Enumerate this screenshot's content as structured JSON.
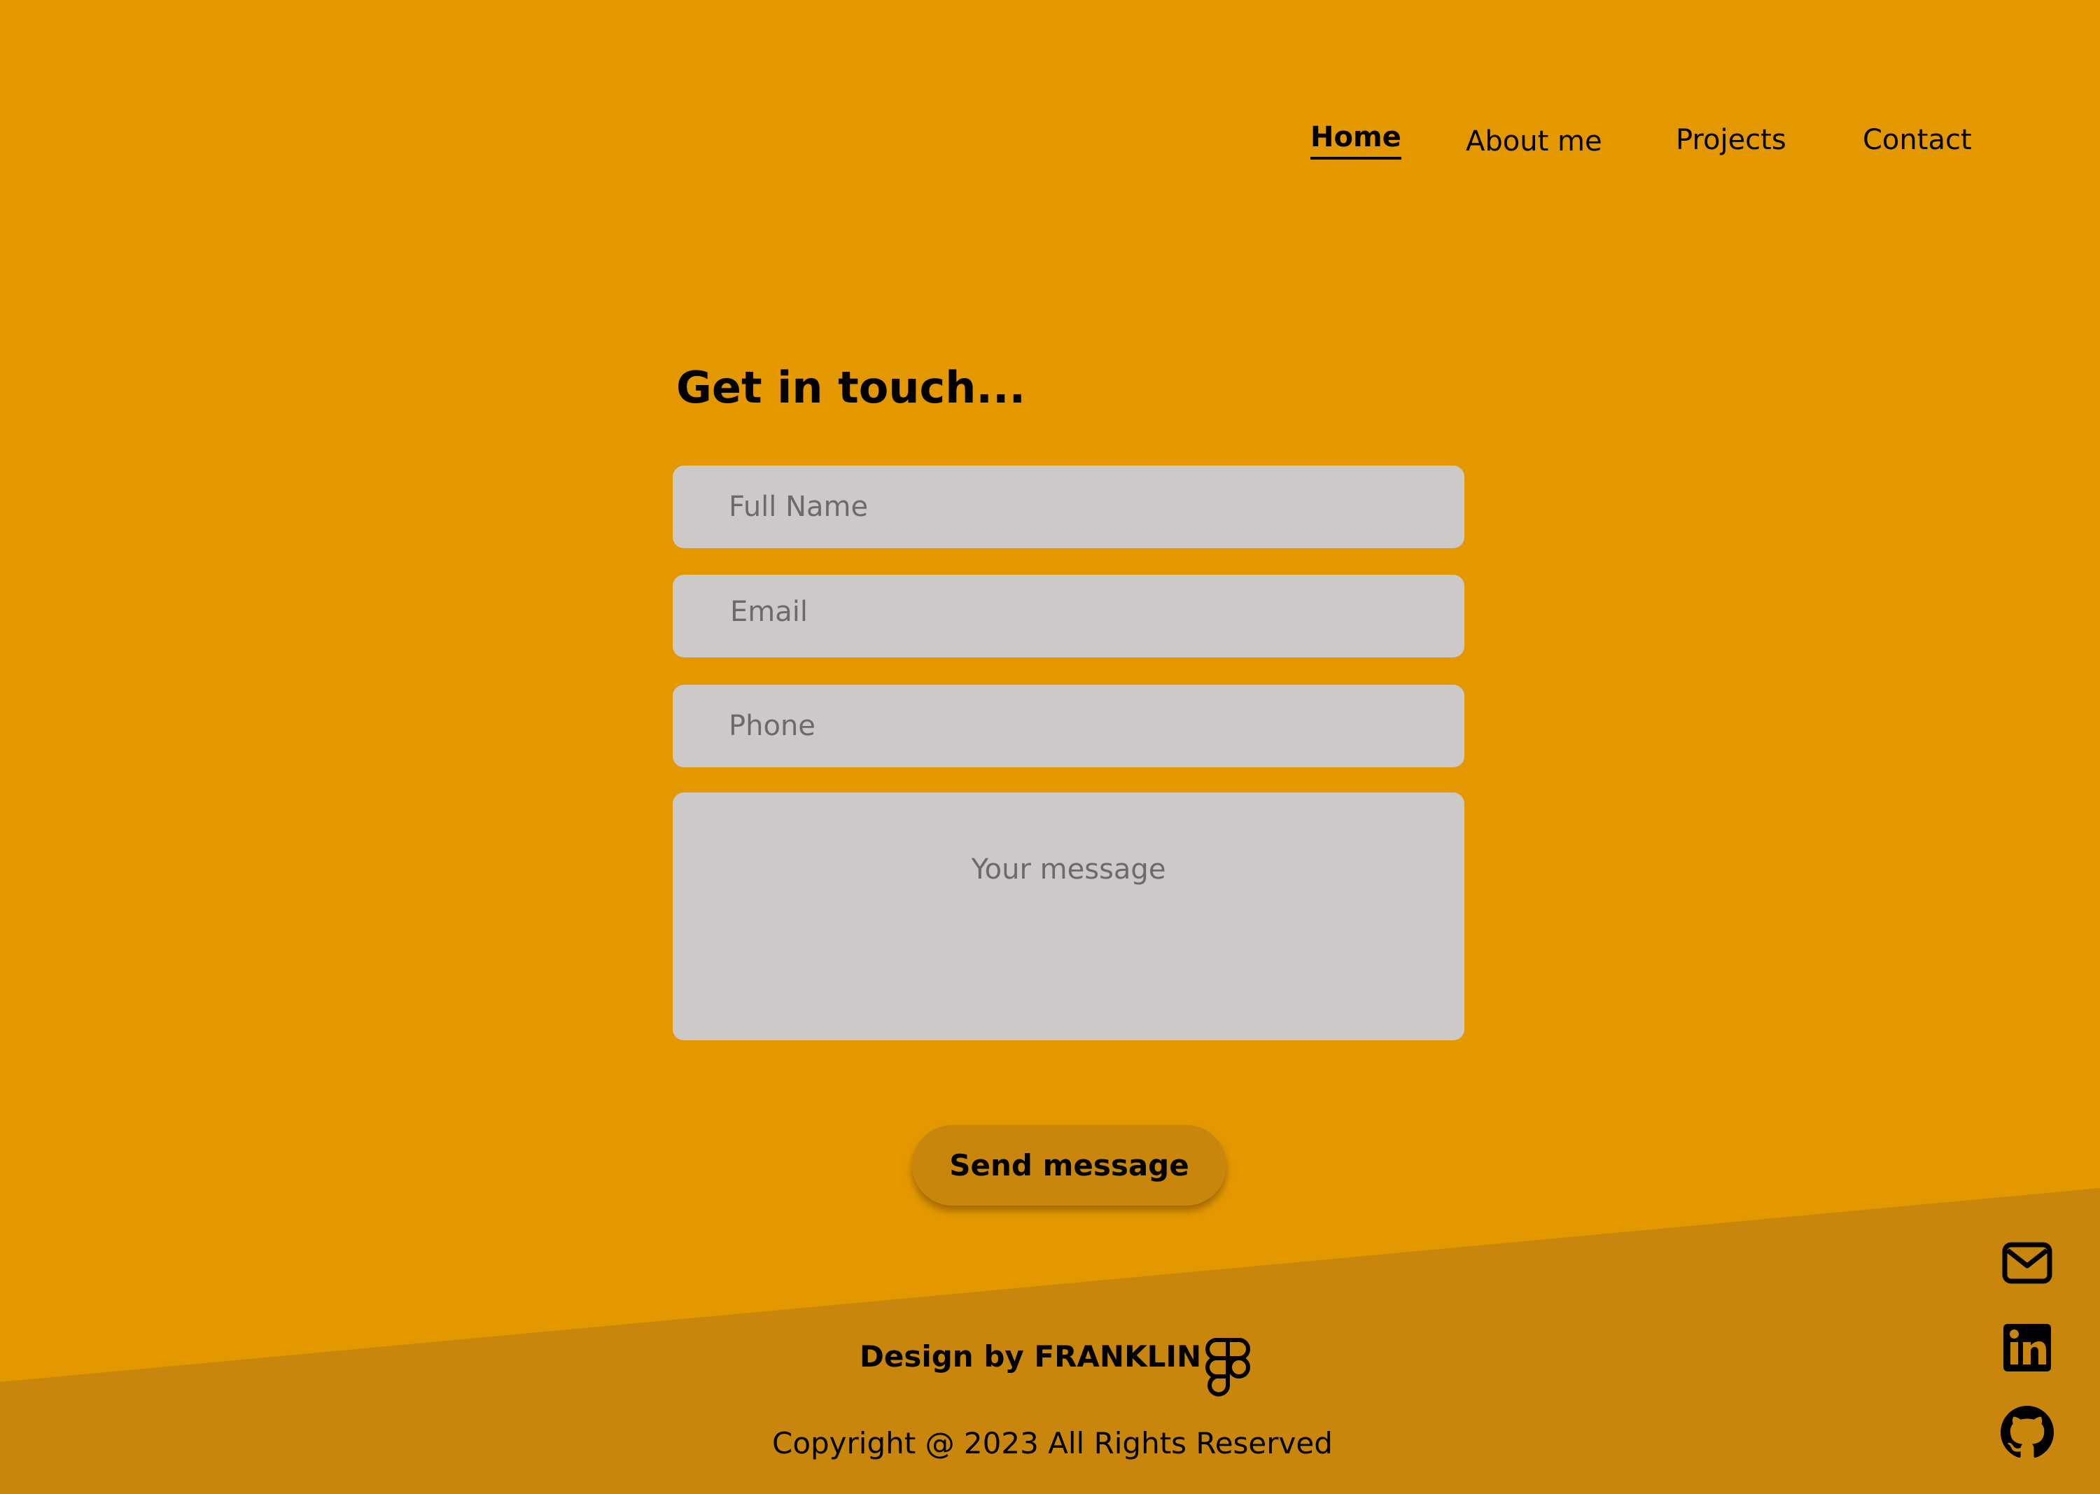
{
  "nav": {
    "items": [
      {
        "label": "Home",
        "active": true
      },
      {
        "label": "About me",
        "active": false
      },
      {
        "label": "Projects",
        "active": false
      },
      {
        "label": "Contact",
        "active": false
      }
    ]
  },
  "contact_form": {
    "heading": "Get in touch...",
    "full_name": {
      "placeholder": "Full Name",
      "value": ""
    },
    "email": {
      "placeholder": "Email",
      "value": ""
    },
    "phone": {
      "placeholder": "Phone",
      "value": ""
    },
    "message": {
      "placeholder": "Your message",
      "value": ""
    },
    "submit_label": "Send message"
  },
  "footer": {
    "credit": "Design by FRANKLIN",
    "credit_icon": "figma-icon",
    "copyright": "Copyright @ 2023 All Rights Reserved",
    "social_icons": [
      "mail-icon",
      "linkedin-icon",
      "github-icon"
    ]
  },
  "colors": {
    "background": "#e49800",
    "footer_band": "#c8860d",
    "field_background": "#cdc9c9",
    "button_background": "#c8860d",
    "text": "#000000"
  }
}
